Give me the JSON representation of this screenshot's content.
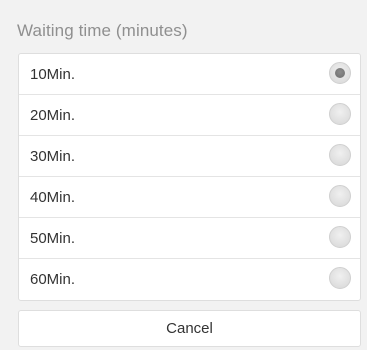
{
  "dialog": {
    "title": "Waiting time (minutes)"
  },
  "options": [
    {
      "label": "10Min.",
      "selected": true
    },
    {
      "label": "20Min.",
      "selected": false
    },
    {
      "label": "30Min.",
      "selected": false
    },
    {
      "label": "40Min.",
      "selected": false
    },
    {
      "label": "50Min.",
      "selected": false
    },
    {
      "label": "60Min.",
      "selected": false
    }
  ],
  "cancel": {
    "label": "Cancel"
  },
  "colors": {
    "background": "#f2f2f2",
    "panel": "#ffffff",
    "title_text": "#8f8f8f",
    "body_text": "#333333",
    "radio_checked": "#7a7a7a"
  }
}
